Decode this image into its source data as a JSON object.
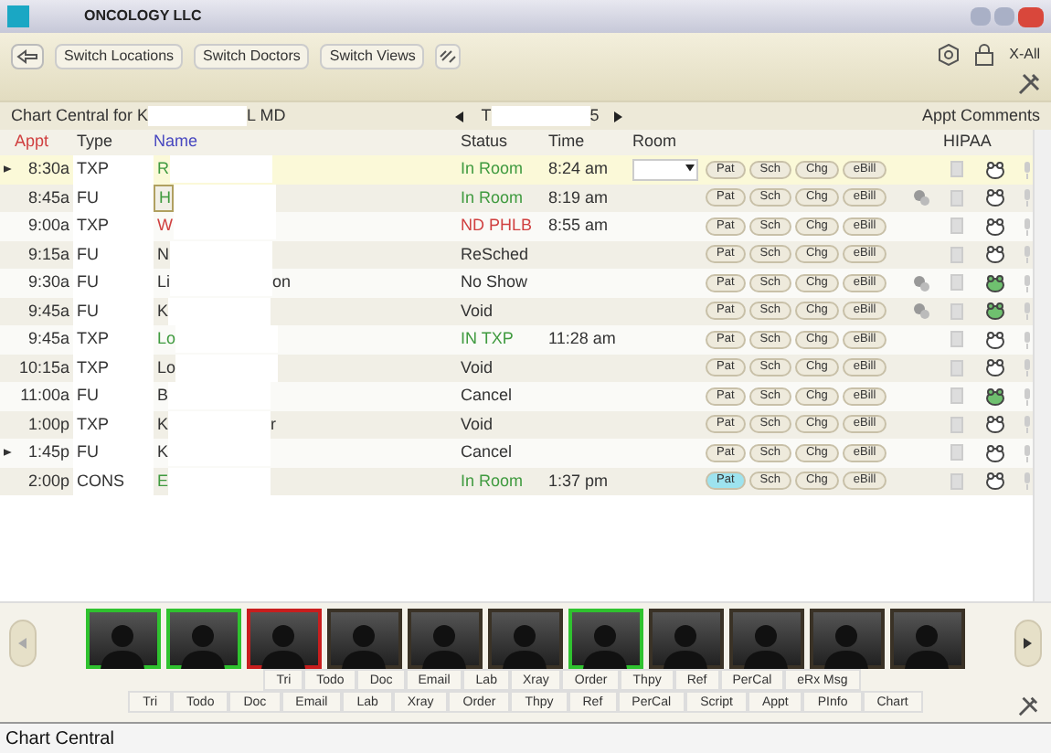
{
  "window": {
    "title": "ONCOLOGY LLC"
  },
  "toolbar": {
    "buttons": [
      "Switch Locations",
      "Switch Doctors",
      "Switch Views"
    ],
    "x_all": "X-All"
  },
  "header": {
    "doctor_prefix": "Chart Central for K",
    "doctor_suffix": "L MD",
    "date_prefix": "T",
    "date_suffix": "5",
    "comments": "Appt Comments"
  },
  "columns": {
    "appt": "Appt",
    "type": "Type",
    "name": "Name",
    "status": "Status",
    "time": "Time",
    "room": "Room",
    "hipaa": "HIPAA"
  },
  "rows": [
    {
      "appt": "8:30a",
      "type": "TXP",
      "name": "R",
      "name_suffix": "",
      "kind": "active",
      "status": "In Room",
      "time": "8:24 am",
      "selected": true,
      "flag": true,
      "note": false,
      "hipaa": false,
      "buttons": [
        {
          "label": "Pat",
          "selected": false
        },
        {
          "label": "Sch",
          "selected": false
        },
        {
          "label": "Chg",
          "selected": false
        },
        {
          "label": "eBill",
          "selected": false
        }
      ]
    },
    {
      "appt": "8:45a",
      "type": "FU",
      "name": "H",
      "name_suffix": "",
      "kind": "active",
      "status": "In Room",
      "time": "8:19 am",
      "selected": false,
      "flag": false,
      "note": true,
      "hipaa": false,
      "buttons": [
        {
          "label": "Pat",
          "selected": false
        },
        {
          "label": "Sch",
          "selected": false
        },
        {
          "label": "Chg",
          "selected": false
        },
        {
          "label": "eBill",
          "selected": false
        }
      ]
    },
    {
      "appt": "9:00a",
      "type": "TXP",
      "name": "W",
      "name_suffix": "",
      "kind": "alert",
      "status": "ND PHLB",
      "time": "8:55 am",
      "selected": false,
      "flag": false,
      "note": false,
      "hipaa": false,
      "buttons": [
        {
          "label": "Pat",
          "selected": false
        },
        {
          "label": "Sch",
          "selected": false
        },
        {
          "label": "Chg",
          "selected": false
        },
        {
          "label": "eBill",
          "selected": false
        }
      ]
    },
    {
      "appt": "9:15a",
      "type": "FU",
      "name": "N",
      "name_suffix": "",
      "kind": "plain",
      "status": "ReSched",
      "time": "",
      "selected": false,
      "flag": false,
      "note": false,
      "hipaa": false,
      "buttons": [
        {
          "label": "Pat",
          "selected": false
        },
        {
          "label": "Sch",
          "selected": false
        },
        {
          "label": "Chg",
          "selected": false
        },
        {
          "label": "eBill",
          "selected": false
        }
      ]
    },
    {
      "appt": "9:30a",
      "type": "FU",
      "name": "Li",
      "name_suffix": "on",
      "kind": "plain",
      "status": "No Show",
      "time": "",
      "selected": false,
      "flag": false,
      "note": true,
      "hipaa": true,
      "buttons": [
        {
          "label": "Pat",
          "selected": false
        },
        {
          "label": "Sch",
          "selected": false
        },
        {
          "label": "Chg",
          "selected": false
        },
        {
          "label": "eBill",
          "selected": false
        }
      ]
    },
    {
      "appt": "9:45a",
      "type": "FU",
      "name": "K",
      "name_suffix": "",
      "kind": "plain",
      "status": "Void",
      "time": "",
      "selected": false,
      "flag": false,
      "note": true,
      "hipaa": true,
      "buttons": [
        {
          "label": "Pat",
          "selected": false
        },
        {
          "label": "Sch",
          "selected": false
        },
        {
          "label": "Chg",
          "selected": false
        },
        {
          "label": "eBill",
          "selected": false
        }
      ]
    },
    {
      "appt": "9:45a",
      "type": "TXP",
      "name": "Lo",
      "name_suffix": "",
      "kind": "active",
      "status": "IN TXP",
      "time": "11:28 am",
      "selected": false,
      "flag": false,
      "note": false,
      "hipaa": false,
      "buttons": [
        {
          "label": "Pat",
          "selected": false
        },
        {
          "label": "Sch",
          "selected": false
        },
        {
          "label": "Chg",
          "selected": false
        },
        {
          "label": "eBill",
          "selected": false
        }
      ]
    },
    {
      "appt": "10:15a",
      "type": "TXP",
      "name": "Lo",
      "name_suffix": "",
      "kind": "plain",
      "status": "Void",
      "time": "",
      "selected": false,
      "flag": false,
      "note": false,
      "hipaa": false,
      "buttons": [
        {
          "label": "Pat",
          "selected": false
        },
        {
          "label": "Sch",
          "selected": false
        },
        {
          "label": "Chg",
          "selected": false
        },
        {
          "label": "eBill",
          "selected": false
        }
      ]
    },
    {
      "appt": "11:00a",
      "type": "FU",
      "name": "B",
      "name_suffix": "",
      "kind": "plain",
      "status": "Cancel",
      "time": "",
      "selected": false,
      "flag": false,
      "note": false,
      "hipaa": true,
      "buttons": [
        {
          "label": "Pat",
          "selected": false
        },
        {
          "label": "Sch",
          "selected": false
        },
        {
          "label": "Chg",
          "selected": false
        },
        {
          "label": "eBill",
          "selected": false
        }
      ]
    },
    {
      "appt": "1:00p",
      "type": "TXP",
      "name": "K",
      "name_suffix": "r",
      "kind": "plain",
      "status": "Void",
      "time": "",
      "selected": false,
      "flag": false,
      "note": false,
      "hipaa": false,
      "buttons": [
        {
          "label": "Pat",
          "selected": false
        },
        {
          "label": "Sch",
          "selected": false
        },
        {
          "label": "Chg",
          "selected": false
        },
        {
          "label": "eBill",
          "selected": false
        }
      ]
    },
    {
      "appt": "1:45p",
      "type": "FU",
      "name": "K",
      "name_suffix": "",
      "kind": "plain",
      "status": "Cancel",
      "time": "",
      "selected": false,
      "flag": true,
      "note": false,
      "hipaa": false,
      "buttons": [
        {
          "label": "Pat",
          "selected": false
        },
        {
          "label": "Sch",
          "selected": false
        },
        {
          "label": "Chg",
          "selected": false
        },
        {
          "label": "eBill",
          "selected": false
        }
      ]
    },
    {
      "appt": "2:00p",
      "type": "CONS",
      "name": "E",
      "name_suffix": "",
      "kind": "active",
      "status": "In Room",
      "time": "1:37 pm",
      "selected": false,
      "flag": false,
      "note": false,
      "hipaa": false,
      "buttons": [
        {
          "label": "Pat",
          "selected": true
        },
        {
          "label": "Sch",
          "selected": false
        },
        {
          "label": "Chg",
          "selected": false
        },
        {
          "label": "eBill",
          "selected": false
        }
      ]
    }
  ],
  "photos": [
    {
      "color": "#2fc22f"
    },
    {
      "color": "#2fc22f"
    },
    {
      "color": "#c81e1e"
    },
    {
      "color": "#3a3226"
    },
    {
      "color": "#3a3226"
    },
    {
      "color": "#3a3226"
    },
    {
      "color": "#2fc22f"
    },
    {
      "color": "#3a3226"
    },
    {
      "color": "#3a3226"
    },
    {
      "color": "#3a3226"
    },
    {
      "color": "#3a3226"
    }
  ],
  "tabs_upper": [
    "Tri",
    "Todo",
    "Doc",
    "Email",
    "Lab",
    "Xray",
    "Order",
    "Thpy",
    "Ref",
    "PerCal",
    "eRx Msg"
  ],
  "tabs_lower": [
    "Tri",
    "Todo",
    "Doc",
    "Email",
    "Lab",
    "Xray",
    "Order",
    "Thpy",
    "Ref",
    "PerCal",
    "Script",
    "Appt",
    "PInfo",
    "Chart"
  ],
  "status_bar": "Chart Central"
}
